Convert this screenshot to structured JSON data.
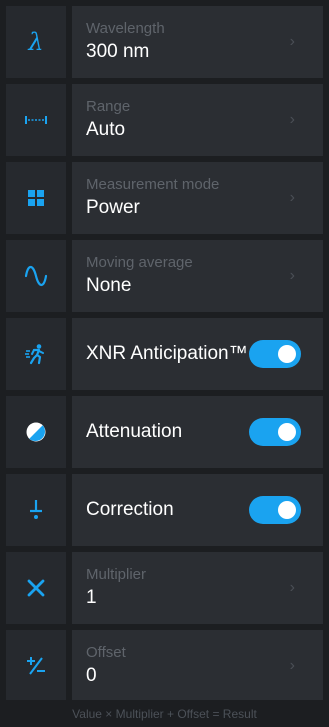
{
  "colors": {
    "accent": "#1aa3f0",
    "background": "#1c1e21",
    "cell": "#2b2e33",
    "icon_cell": "#26292e",
    "label": "#5f646b",
    "value": "#ffffff"
  },
  "rows": [
    {
      "icon": "lambda-icon",
      "label": "Wavelength",
      "value": "300 nm"
    },
    {
      "icon": "range-icon",
      "label": "Range",
      "value": "Auto"
    },
    {
      "icon": "grid-icon",
      "label": "Measurement mode",
      "value": "Power"
    },
    {
      "icon": "sine-wave-icon",
      "label": "Moving average",
      "value": "None"
    }
  ],
  "toggles": [
    {
      "icon": "running-person-icon",
      "label": "XNR Anticipation™",
      "on": true
    },
    {
      "icon": "contrast-icon",
      "label": "Attenuation",
      "on": true
    },
    {
      "icon": "correction-icon",
      "label": "Correction",
      "on": true
    }
  ],
  "rows2": [
    {
      "icon": "multiply-icon",
      "label": "Multiplier",
      "value": "1"
    },
    {
      "icon": "plus-minus-icon",
      "label": "Offset",
      "value": "0"
    }
  ],
  "chevron": "›",
  "footer": "Value × Multiplier + Offset = Result"
}
